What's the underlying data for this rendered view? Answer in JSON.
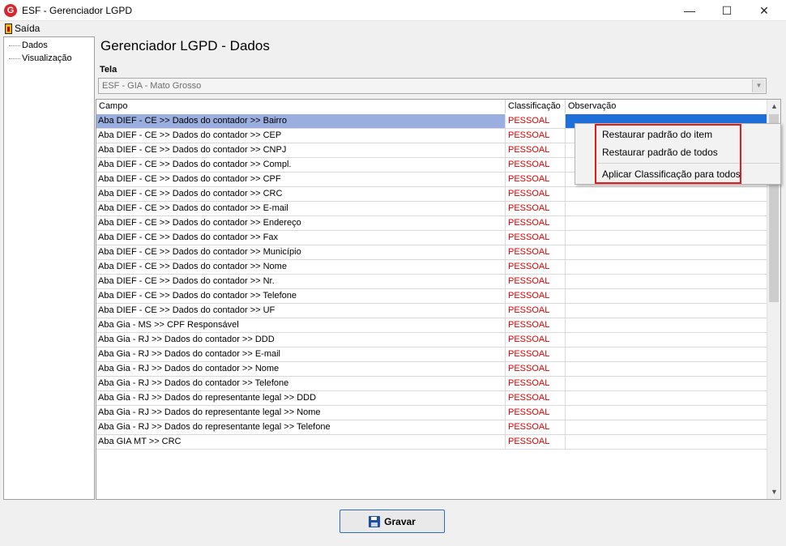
{
  "window": {
    "title": "ESF - Gerenciador LGPD",
    "logo_letter": "G",
    "minimize_glyph": "—",
    "maximize_glyph": "☐",
    "close_glyph": "✕"
  },
  "menu": {
    "exit_label": "Saída"
  },
  "sidebar": {
    "items": [
      {
        "label": "Dados"
      },
      {
        "label": "Visualização"
      }
    ]
  },
  "page": {
    "title": "Gerenciador LGPD - Dados"
  },
  "tela": {
    "label": "Tela",
    "selected": "ESF - GIA - Mato Grosso"
  },
  "grid": {
    "columns": {
      "campo": "Campo",
      "classificacao": "Classificação",
      "observacao": "Observação"
    },
    "rows": [
      {
        "campo": "Aba DIEF - CE >> Dados do contador >> Bairro",
        "cls": "PESSOAL",
        "obs": ""
      },
      {
        "campo": "Aba DIEF - CE >> Dados do contador >> CEP",
        "cls": "PESSOAL",
        "obs": ""
      },
      {
        "campo": "Aba DIEF - CE >> Dados do contador >> CNPJ",
        "cls": "PESSOAL",
        "obs": ""
      },
      {
        "campo": "Aba DIEF - CE >> Dados do contador >> Compl.",
        "cls": "PESSOAL",
        "obs": ""
      },
      {
        "campo": "Aba DIEF - CE >> Dados do contador >> CPF",
        "cls": "PESSOAL",
        "obs": ""
      },
      {
        "campo": "Aba DIEF - CE >> Dados do contador >> CRC",
        "cls": "PESSOAL",
        "obs": ""
      },
      {
        "campo": "Aba DIEF - CE >> Dados do contador >> E-mail",
        "cls": "PESSOAL",
        "obs": ""
      },
      {
        "campo": "Aba DIEF - CE >> Dados do contador >> Endereço",
        "cls": "PESSOAL",
        "obs": ""
      },
      {
        "campo": "Aba DIEF - CE >> Dados do contador >> Fax",
        "cls": "PESSOAL",
        "obs": ""
      },
      {
        "campo": "Aba DIEF - CE >> Dados do contador >> Município",
        "cls": "PESSOAL",
        "obs": ""
      },
      {
        "campo": "Aba DIEF - CE >> Dados do contador >> Nome",
        "cls": "PESSOAL",
        "obs": ""
      },
      {
        "campo": "Aba DIEF - CE >> Dados do contador >> Nr.",
        "cls": "PESSOAL",
        "obs": ""
      },
      {
        "campo": "Aba DIEF - CE >> Dados do contador >> Telefone",
        "cls": "PESSOAL",
        "obs": ""
      },
      {
        "campo": "Aba DIEF - CE >> Dados do contador >> UF",
        "cls": "PESSOAL",
        "obs": ""
      },
      {
        "campo": "Aba Gia - MS >> CPF Responsável",
        "cls": "PESSOAL",
        "obs": ""
      },
      {
        "campo": "Aba Gia - RJ >> Dados do contador >> DDD",
        "cls": "PESSOAL",
        "obs": ""
      },
      {
        "campo": "Aba Gia - RJ >> Dados do contador >> E-mail",
        "cls": "PESSOAL",
        "obs": ""
      },
      {
        "campo": "Aba Gia - RJ >> Dados do contador >> Nome",
        "cls": "PESSOAL",
        "obs": ""
      },
      {
        "campo": "Aba Gia - RJ >> Dados do contador >> Telefone",
        "cls": "PESSOAL",
        "obs": ""
      },
      {
        "campo": "Aba Gia - RJ >> Dados do representante legal >> DDD",
        "cls": "PESSOAL",
        "obs": ""
      },
      {
        "campo": "Aba Gia - RJ >> Dados do representante legal >> Nome",
        "cls": "PESSOAL",
        "obs": ""
      },
      {
        "campo": "Aba Gia - RJ >> Dados do representante legal >> Telefone",
        "cls": "PESSOAL",
        "obs": ""
      },
      {
        "campo": "Aba GIA MT >> CRC",
        "cls": "PESSOAL",
        "obs": ""
      }
    ]
  },
  "context_menu": {
    "items": [
      {
        "label": "Restaurar padrão do item"
      },
      {
        "label": "Restaurar padrão de todos"
      },
      {
        "label": "Aplicar Classificação para todos"
      }
    ]
  },
  "footer": {
    "save_label": "Gravar"
  },
  "colors": {
    "classification_text": "#e00000",
    "selected_row": "#9aaee0",
    "highlight_box": "#e31b1b",
    "button_border": "#2b6cc4"
  }
}
